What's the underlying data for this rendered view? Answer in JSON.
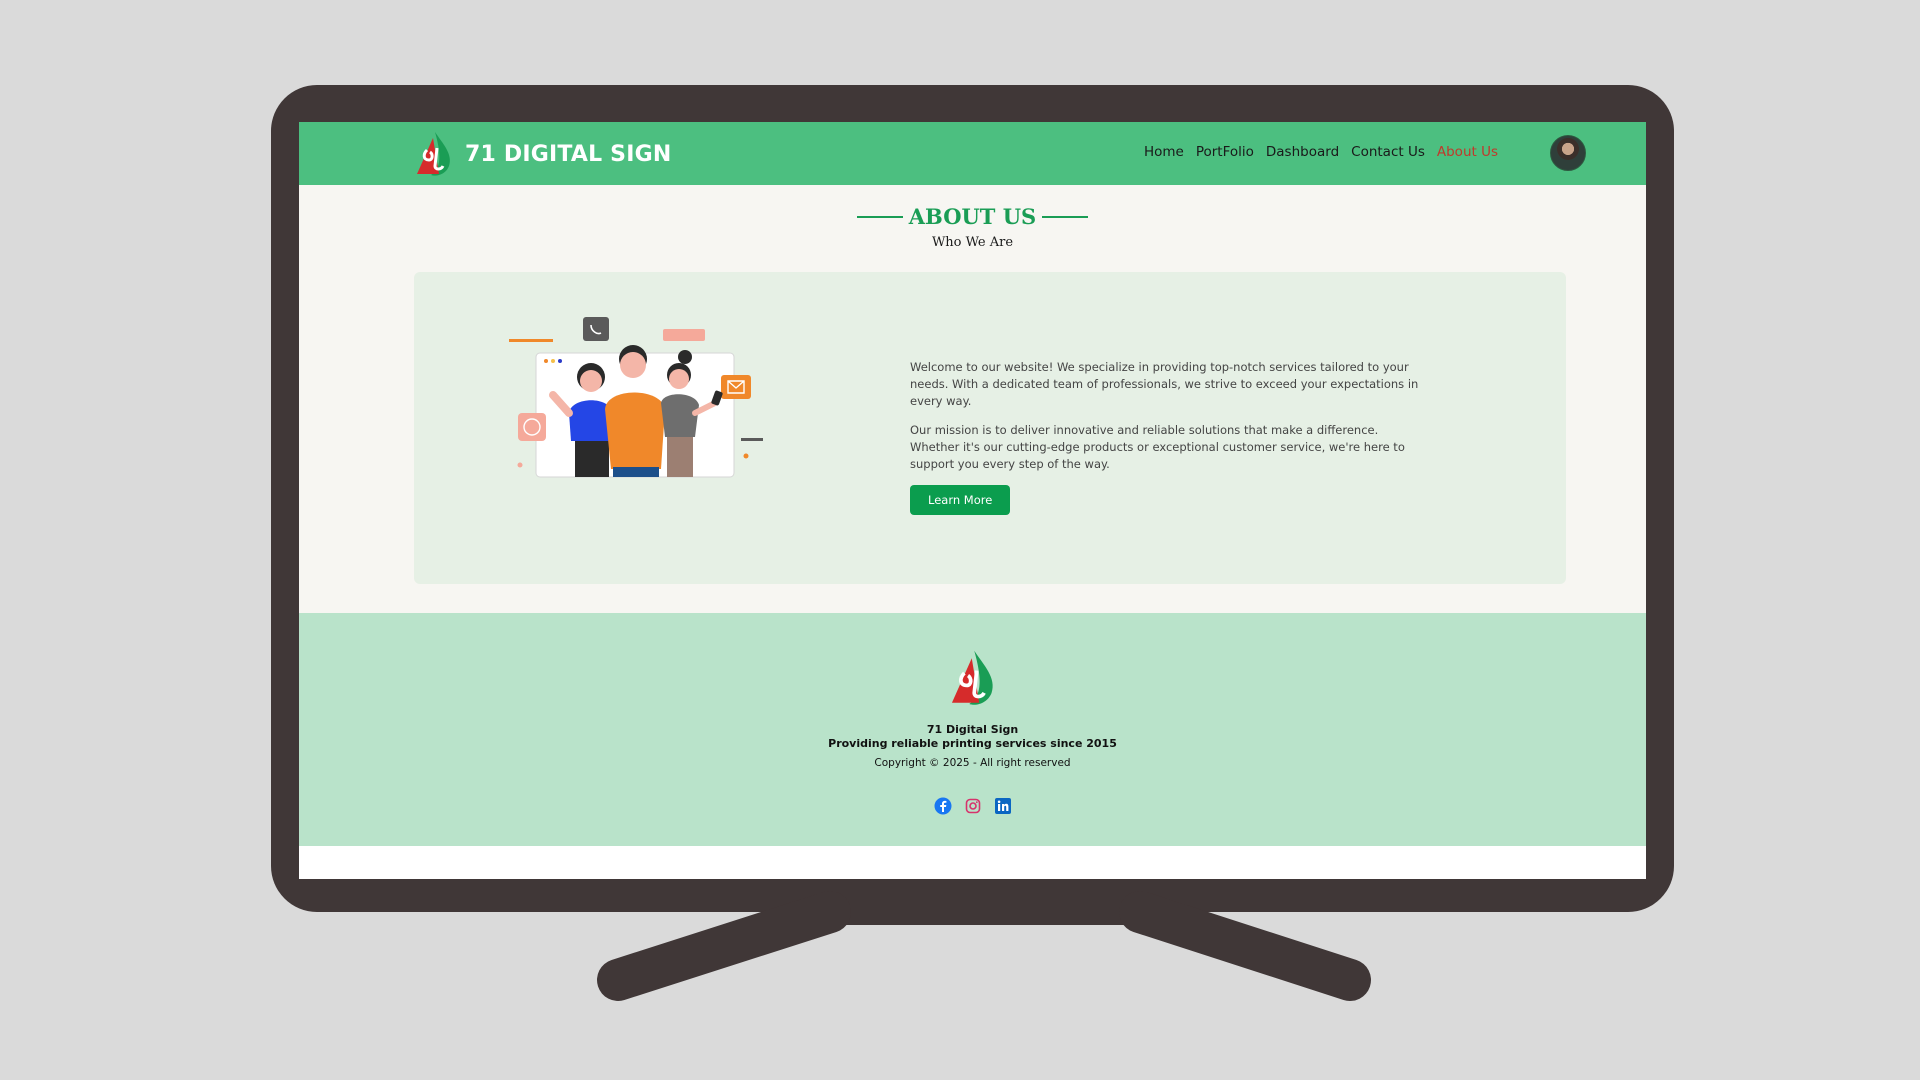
{
  "brand": {
    "name": "71 DIGITAL SIGN"
  },
  "nav": {
    "items": [
      {
        "label": "Home"
      },
      {
        "label": "PortFolio"
      },
      {
        "label": "Dashboard"
      },
      {
        "label": "Contact Us"
      },
      {
        "label": "About Us",
        "active": true
      }
    ]
  },
  "about": {
    "title": "ABOUT US",
    "subtitle": "Who We Are",
    "paragraph1": "Welcome to our website! We specialize in providing top-notch services tailored to your needs. With a dedicated team of professionals, we strive to exceed your expectations in every way.",
    "paragraph2": "Our mission is to deliver innovative and reliable solutions that make a difference. Whether it's our cutting-edge products or exceptional customer service, we're here to support you every step of the way.",
    "button_label": "Learn More"
  },
  "footer": {
    "company": "71 Digital Sign",
    "tagline": "Providing reliable printing services since 2015",
    "copyright": "Copyright © 2025 - All right reserved",
    "socials": [
      {
        "icon": "facebook-icon"
      },
      {
        "icon": "instagram-icon"
      },
      {
        "icon": "linkedin-icon"
      }
    ]
  },
  "colors": {
    "header_bg": "#4cbf80",
    "accent_green": "#1a9d55",
    "active_nav": "#c0392b",
    "footer_bg": "#b9e3ca",
    "card_bg": "#e6f0e5"
  }
}
